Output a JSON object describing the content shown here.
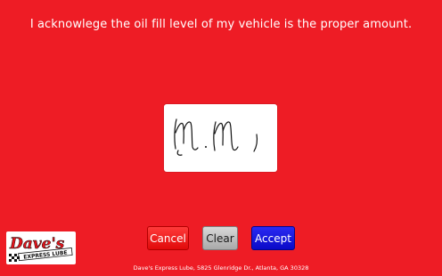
{
  "prompt": {
    "text": "I acknowlege the oil fill level of my vehicle is the proper amount."
  },
  "signature_pad": {
    "signature": "M.M,"
  },
  "buttons": {
    "cancel": "Cancel",
    "clear": "Clear",
    "accept": "Accept"
  },
  "logo": {
    "name": "Dave's",
    "tagline": "EXPRESS LUBE"
  },
  "footer": {
    "address": "Dave's Express Lube, 5825 Glenridge Dr., Atlanta, GA 30328"
  },
  "colors": {
    "background": "#ee1c25",
    "cancel": "#e00a0a",
    "clear": "#a9a9a9",
    "accept": "#0a0ac8"
  }
}
